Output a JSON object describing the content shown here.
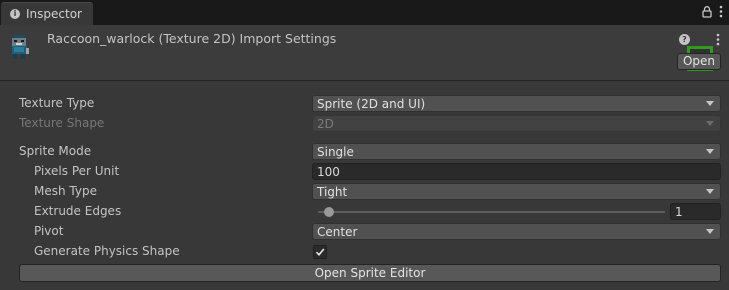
{
  "tab": {
    "label": "Inspector",
    "icon": "info-icon"
  },
  "header": {
    "title": "Raccoon_warlock (Texture 2D) Import Settings",
    "open_button": "Open"
  },
  "fields": {
    "texture_type": {
      "label": "Texture Type",
      "value": "Sprite (2D and UI)"
    },
    "texture_shape": {
      "label": "Texture Shape",
      "value": "2D"
    },
    "sprite_mode": {
      "label": "Sprite Mode",
      "value": "Single"
    },
    "pixels_per_unit": {
      "label": "Pixels Per Unit",
      "value": "100"
    },
    "mesh_type": {
      "label": "Mesh Type",
      "value": "Tight"
    },
    "extrude_edges": {
      "label": "Extrude Edges",
      "value": "1"
    },
    "pivot": {
      "label": "Pivot",
      "value": "Center"
    },
    "generate_physics_shape": {
      "label": "Generate Physics Shape",
      "checked": true
    }
  },
  "sprite_editor_button": "Open Sprite Editor",
  "colors": {
    "background": "#383838",
    "tabbar": "#191919",
    "preset_highlight": "#2f9a1d"
  }
}
